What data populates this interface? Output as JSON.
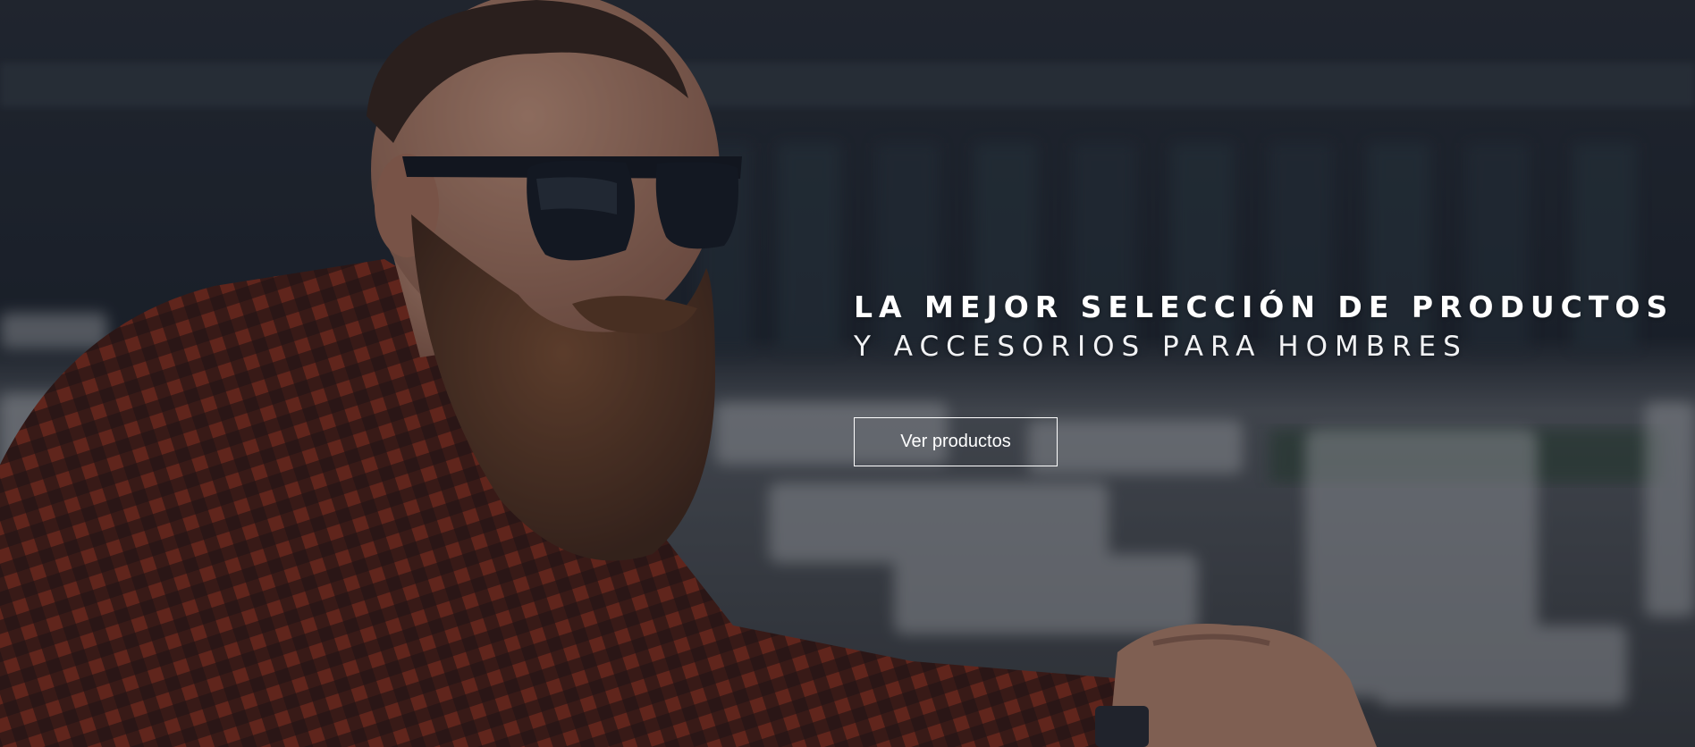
{
  "hero": {
    "headline": "LA MEJOR SELECCIÓN DE PRODUCTOS",
    "subheadline": "Y ACCESORIOS PARA HOMBRES",
    "cta_label": "Ver productos"
  },
  "colors": {
    "overlay": "#1b2029",
    "plaid_red": "#b23a20",
    "plaid_dark": "#2a1612",
    "beard": "#6b3f24",
    "skin": "#c98c6e",
    "text": "#ffffff"
  }
}
